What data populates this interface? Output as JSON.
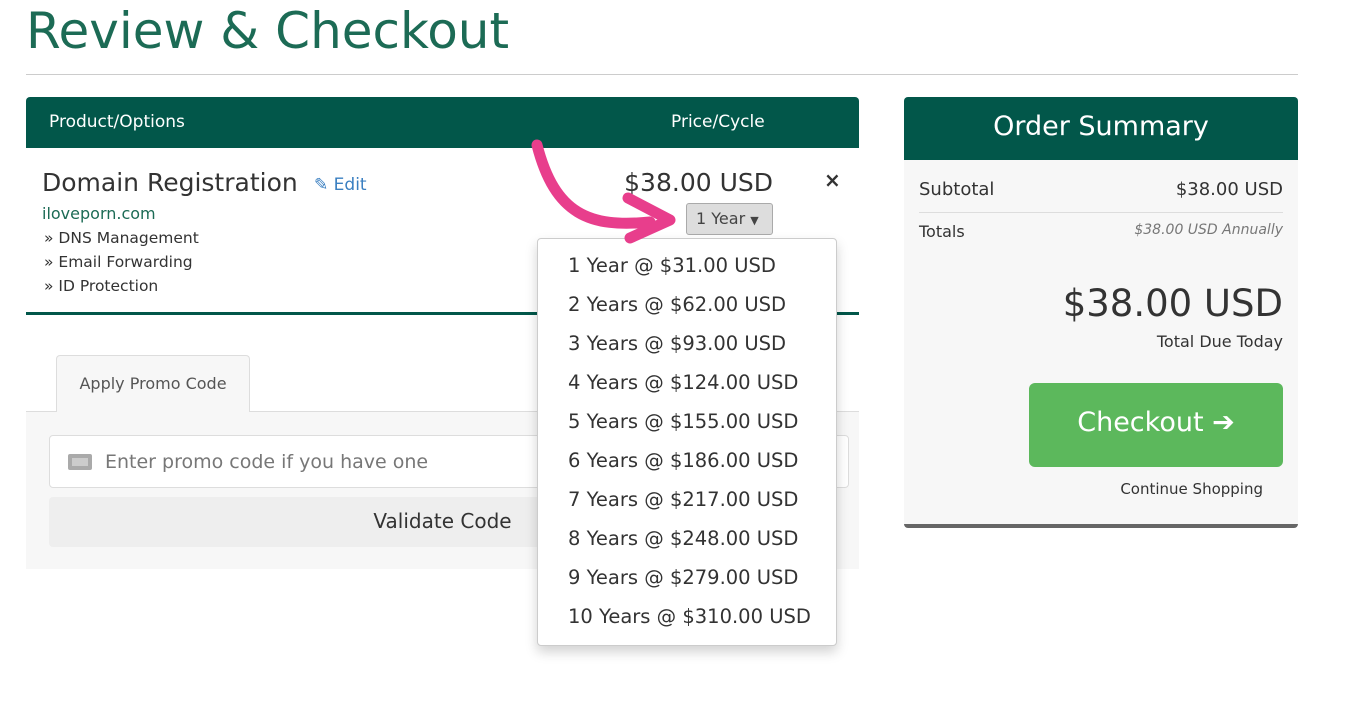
{
  "page": {
    "title": "Review & Checkout"
  },
  "cart": {
    "headers": {
      "product": "Product/Options",
      "price": "Price/Cycle"
    },
    "item": {
      "name": "Domain Registration",
      "edit_label": "Edit",
      "domain": "iloveporn.com",
      "options": [
        "» DNS Management",
        "» Email Forwarding",
        "» ID Protection"
      ],
      "price": "$38.00 USD",
      "cycle_selected": "1 Year",
      "remove_label": "×"
    },
    "cycle_options": [
      "1 Year @ $31.00 USD",
      "2 Years @ $62.00 USD",
      "3 Years @ $93.00 USD",
      "4 Years @ $124.00 USD",
      "5 Years @ $155.00 USD",
      "6 Years @ $186.00 USD",
      "7 Years @ $217.00 USD",
      "8 Years @ $248.00 USD",
      "9 Years @ $279.00 USD",
      "10 Years @ $310.00 USD"
    ]
  },
  "promo": {
    "tab_label": "Apply Promo Code",
    "placeholder": "Enter promo code if you have one",
    "validate_label": "Validate Code"
  },
  "summary": {
    "title": "Order Summary",
    "subtotal_label": "Subtotal",
    "subtotal": "$38.00 USD",
    "totals_label": "Totals",
    "totals_value": "$38.00 USD Annually",
    "total_due": "$38.00 USD",
    "total_due_label": "Total Due Today",
    "checkout_label": "Checkout",
    "continue_label": "Continue Shopping"
  },
  "colors": {
    "brand": "#02574a",
    "checkout": "#5cb85c",
    "annotation_arrow": "#e83e8c"
  }
}
